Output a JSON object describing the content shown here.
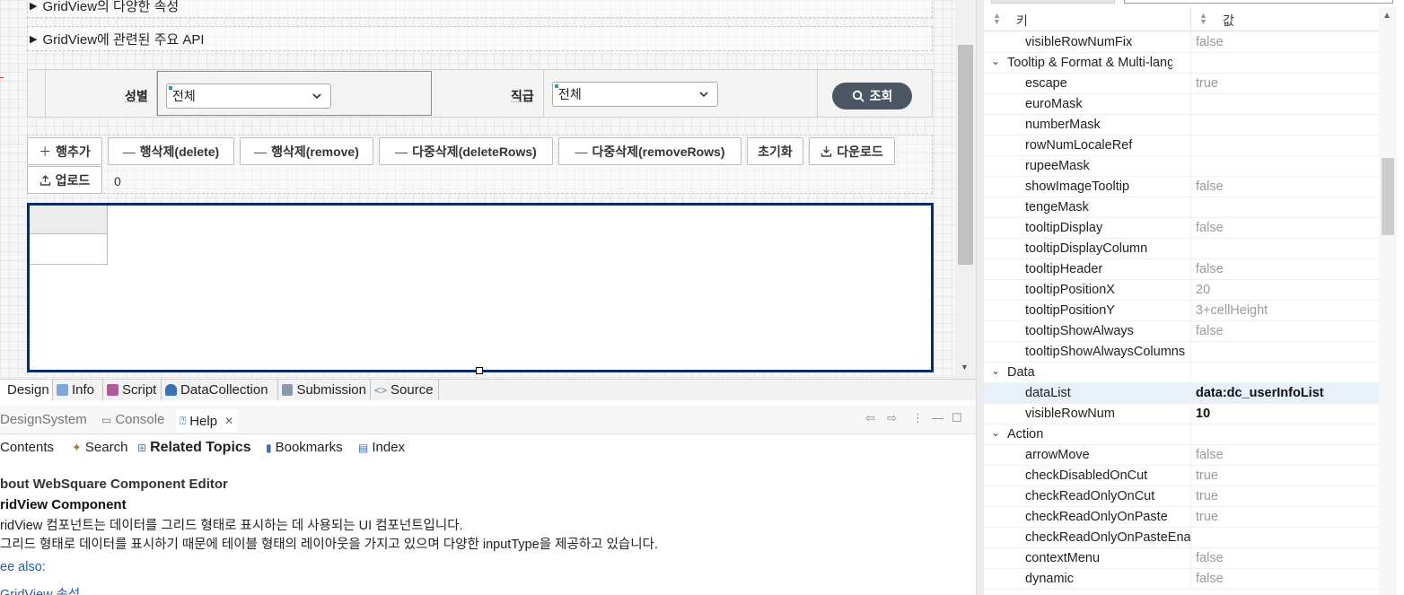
{
  "editor": {
    "accordion": [
      "GridView의 다양한 속성",
      "GridView에 관련된 주요 API"
    ],
    "search_form": {
      "gender_label": "성별",
      "gender_value": "전체",
      "rank_label": "직급",
      "rank_value": "전체",
      "search_button": "조회"
    },
    "toolbar": {
      "add_row": "행추가",
      "delete_row": "행삭제(delete)",
      "remove_row": "행삭제(remove)",
      "delete_rows": "다중삭제(deleteRows)",
      "remove_rows": "다중삭제(removeRows)",
      "reset": "초기화",
      "download": "다운로드",
      "upload": "업로드",
      "row_count": "0"
    }
  },
  "editor_tabs": [
    "Design",
    "Info",
    "Script",
    "DataCollection",
    "Submission",
    "Source"
  ],
  "help_panel": {
    "tabs": [
      "DesignSystem",
      "Console",
      "Help"
    ],
    "nav": [
      "Contents",
      "Search",
      "Related Topics",
      "Bookmarks",
      "Index"
    ],
    "about": "bout WebSquare Component Editor",
    "component_title": "ridView Component",
    "desc_line1": "ridView 컴포넌트는 데이터를 그리드 형태로 표시하는 데 사용되는 UI 컴포넌트입니다.",
    "desc_line2": "그리드 형태로 데이터를 표시하기 때문에 테이블 형태의 레이아웃을 가지고 있으며 다양한 inputType을 제공하고 있습니다.",
    "see_also": "ee also:",
    "link": "GridView 속성"
  },
  "properties": {
    "header_key": "키",
    "header_value": "값",
    "rows": [
      {
        "type": "prop",
        "key": "visibleRowNumFix",
        "value": "false"
      },
      {
        "type": "cat",
        "key": "Tooltip & Format & Multi-lang",
        "value": ""
      },
      {
        "type": "prop",
        "key": "escape",
        "value": "true"
      },
      {
        "type": "prop",
        "key": "euroMask",
        "value": ""
      },
      {
        "type": "prop",
        "key": "numberMask",
        "value": ""
      },
      {
        "type": "prop",
        "key": "rowNumLocaleRef",
        "value": ""
      },
      {
        "type": "prop",
        "key": "rupeeMask",
        "value": ""
      },
      {
        "type": "prop",
        "key": "showImageTooltip",
        "value": "false"
      },
      {
        "type": "prop",
        "key": "tengeMask",
        "value": ""
      },
      {
        "type": "prop",
        "key": "tooltipDisplay",
        "value": "false"
      },
      {
        "type": "prop",
        "key": "tooltipDisplayColumn",
        "value": ""
      },
      {
        "type": "prop",
        "key": "tooltipHeader",
        "value": "false"
      },
      {
        "type": "prop",
        "key": "tooltipPositionX",
        "value": "20"
      },
      {
        "type": "prop",
        "key": "tooltipPositionY",
        "value": "3+cellHeight"
      },
      {
        "type": "prop",
        "key": "tooltipShowAlways",
        "value": "false"
      },
      {
        "type": "prop",
        "key": "tooltipShowAlwaysColumns",
        "value": ""
      },
      {
        "type": "cat",
        "key": "Data",
        "value": ""
      },
      {
        "type": "prop",
        "key": "dataList",
        "value": "data:dc_userInfoList",
        "strong": true,
        "selected": true
      },
      {
        "type": "prop",
        "key": "visibleRowNum",
        "value": "10",
        "strong": true
      },
      {
        "type": "cat",
        "key": "Action",
        "value": ""
      },
      {
        "type": "prop",
        "key": "arrowMove",
        "value": "false"
      },
      {
        "type": "prop",
        "key": "checkDisabledOnCut",
        "value": "true"
      },
      {
        "type": "prop",
        "key": "checkReadOnlyOnCut",
        "value": "true"
      },
      {
        "type": "prop",
        "key": "checkReadOnlyOnPaste",
        "value": "true"
      },
      {
        "type": "prop",
        "key": "checkReadOnlyOnPasteEnable",
        "value": ""
      },
      {
        "type": "prop",
        "key": "contextMenu",
        "value": "false"
      },
      {
        "type": "prop",
        "key": "dynamic",
        "value": "false"
      }
    ]
  },
  "colors": {
    "grid_border": "#0b2a66",
    "search_button": "#4d5763",
    "selected_row": "#e8f0fa",
    "link": "#1a5fb4"
  }
}
